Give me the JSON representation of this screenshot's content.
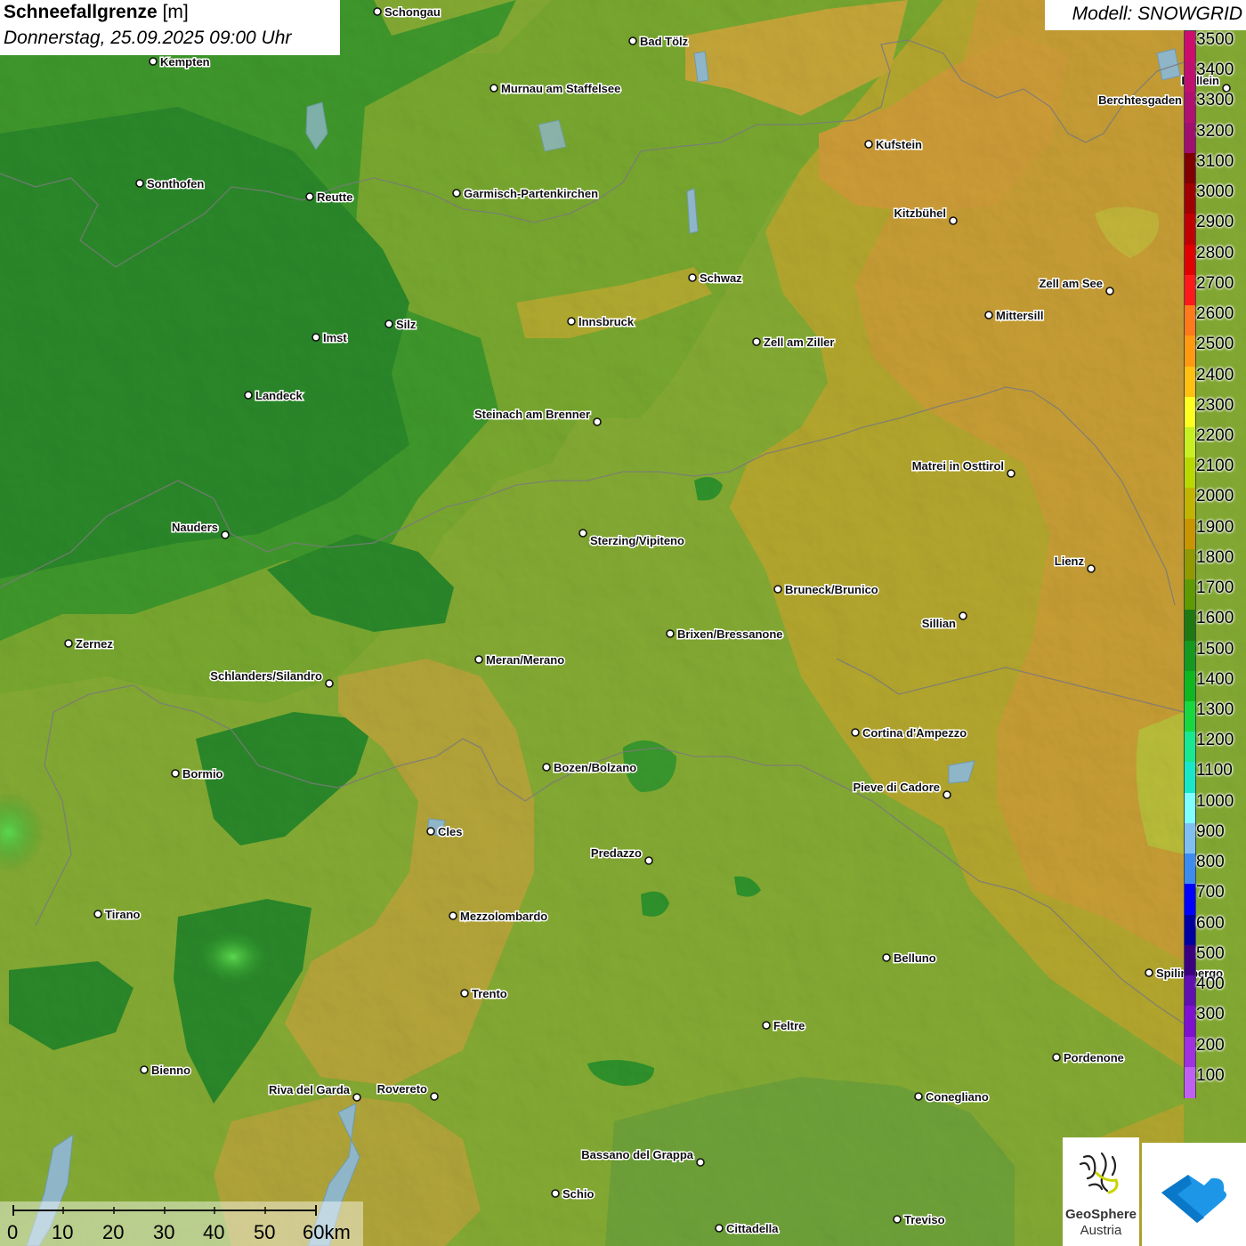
{
  "header": {
    "title_bold": "Schneefallgrenze",
    "title_unit": " [m]",
    "date_time": "Donnerstag, 25.09.2025 09:00 Uhr"
  },
  "model": {
    "label": "Modell: SNOWGRID"
  },
  "legend": {
    "labels": [
      "3500",
      "3400",
      "3300",
      "3200",
      "3100",
      "3000",
      "2900",
      "2800",
      "2700",
      "2600",
      "2500",
      "2400",
      "2300",
      "2200",
      "2100",
      "2000",
      "1900",
      "1800",
      "1700",
      "1600",
      "1500",
      "1400",
      "1300",
      "1200",
      "1100",
      "1000",
      "900",
      "800",
      "700",
      "600",
      "500",
      "400",
      "300",
      "200",
      "100"
    ],
    "colors": [
      "#cc0d6e",
      "#c0106f",
      "#b01070",
      "#a00f6e",
      "#800000",
      "#a00000",
      "#c00000",
      "#e00000",
      "#ff1a1a",
      "#ff7a1a",
      "#ff9a10",
      "#ffc010",
      "#ffff20",
      "#c8f020",
      "#b8d800",
      "#c0b400",
      "#c89400",
      "#909a00",
      "#5e9a00",
      "#1e7a10",
      "#159a20",
      "#10b820",
      "#18d840",
      "#18e890",
      "#18e8c8",
      "#80ffff",
      "#80c0f0",
      "#3c8cf0",
      "#0000ff",
      "#0000a0",
      "#3a0080",
      "#6010b0",
      "#8010d0",
      "#a030e0",
      "#c060f0"
    ]
  },
  "cities": [
    {
      "name": "Schongau"
    },
    {
      "name": "Bad Tölz"
    },
    {
      "name": "Kempten"
    },
    {
      "name": "Murnau am Staffelsee"
    },
    {
      "name": "Hallein"
    },
    {
      "name": "Berchtesgaden"
    },
    {
      "name": "Kufstein"
    },
    {
      "name": "Sonthofen"
    },
    {
      "name": "Reutte"
    },
    {
      "name": "Garmisch-Partenkirchen"
    },
    {
      "name": "Kitzbühel"
    },
    {
      "name": "Schwaz"
    },
    {
      "name": "Zell am See"
    },
    {
      "name": "Innsbruck"
    },
    {
      "name": "Mittersill"
    },
    {
      "name": "Silz"
    },
    {
      "name": "Imst"
    },
    {
      "name": "Zell am Ziller"
    },
    {
      "name": "Landeck"
    },
    {
      "name": "Steinach am Brenner"
    },
    {
      "name": "Matrei in Osttirol"
    },
    {
      "name": "Nauders"
    },
    {
      "name": "Sterzing/Vipiteno"
    },
    {
      "name": "Lienz"
    },
    {
      "name": "Bruneck/Brunico"
    },
    {
      "name": "Sillian"
    },
    {
      "name": "Brixen/Bressanone"
    },
    {
      "name": "Zernez"
    },
    {
      "name": "Meran/Merano"
    },
    {
      "name": "Schlanders/Silandro"
    },
    {
      "name": "Cortina d'Ampezzo"
    },
    {
      "name": "Bozen/Bolzano"
    },
    {
      "name": "Bormio"
    },
    {
      "name": "Pieve di Cadore"
    },
    {
      "name": "Cles"
    },
    {
      "name": "Predazzo"
    },
    {
      "name": "Tirano"
    },
    {
      "name": "Mezzolombardo"
    },
    {
      "name": "Belluno"
    },
    {
      "name": "Spilimbergo"
    },
    {
      "name": "Trento"
    },
    {
      "name": "Feltre"
    },
    {
      "name": "Pordenone"
    },
    {
      "name": "Bienno"
    },
    {
      "name": "Riva del Garda"
    },
    {
      "name": "Rovereto"
    },
    {
      "name": "Conegliano"
    },
    {
      "name": "Bassano del Grappa"
    },
    {
      "name": "Schio"
    },
    {
      "name": "Treviso"
    },
    {
      "name": "Cittadella"
    }
  ],
  "scale": {
    "labels": [
      "0",
      "10",
      "20",
      "30",
      "40",
      "50",
      "60km"
    ]
  },
  "logos": {
    "geosphere_name": "GeoSphere",
    "geosphere_sub": "Austria"
  }
}
